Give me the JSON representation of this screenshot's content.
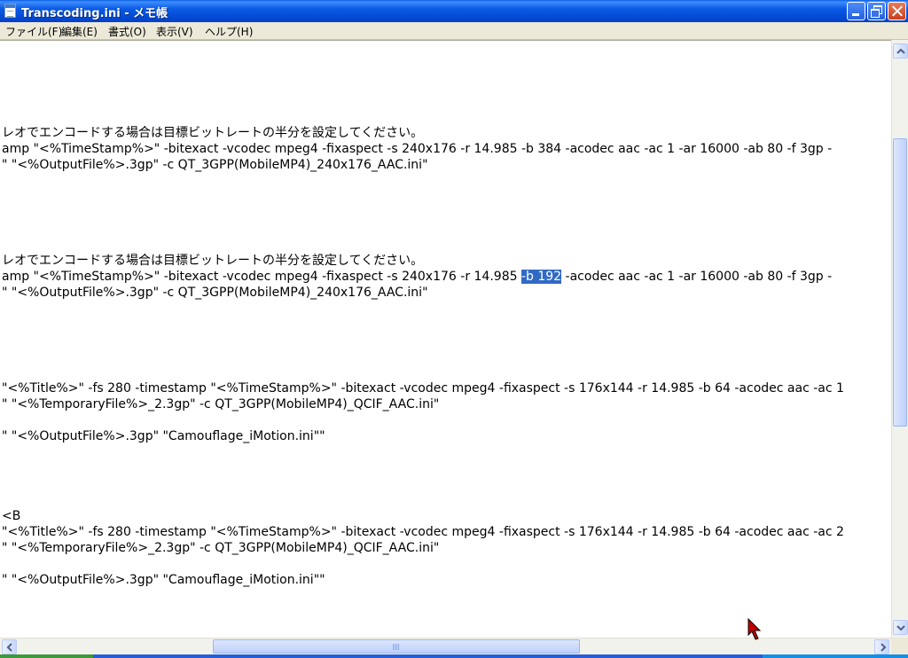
{
  "window": {
    "title": "Transcoding.ini - メモ帳"
  },
  "menu": [
    {
      "label": "ファイル(F)"
    },
    {
      "label": "編集(E)"
    },
    {
      "label": "書式(O)"
    },
    {
      "label": "表示(V)"
    },
    {
      "label": "ヘルプ(H)"
    }
  ],
  "editor": {
    "lines": [
      {
        "text": "レオでエンコードする場合は目標ビットレートの半分を設定してください。"
      },
      {
        "text": "amp \"<%TimeStamp%>\" -bitexact -vcodec mpeg4 -fixaspect -s 240x176 -r 14.985 -b 384 -acodec aac -ac 1 -ar 16000 -ab 80 -f 3gp -"
      },
      {
        "text": "\" \"<%OutputFile%>.3gp\" -c QT_3GPP(MobileMP4)_240x176_AAC.ini\""
      },
      {
        "text": "レオでエンコードする場合は目標ビットレートの半分を設定してください。"
      },
      {
        "before": "amp \"<%TimeStamp%>\" -bitexact -vcodec mpeg4 -fixaspect -s 240x176 -r 14.985 ",
        "selected": "-b 192",
        "after": " -acodec aac -ac 1 -ar 16000 -ab 80 -f 3gp -"
      },
      {
        "text": "\" \"<%OutputFile%>.3gp\" -c QT_3GPP(MobileMP4)_240x176_AAC.ini\""
      },
      {
        "text": "\"<%Title%>\" -fs 280 -timestamp \"<%TimeStamp%>\" -bitexact -vcodec mpeg4 -fixaspect -s 176x144 -r 14.985 -b 64 -acodec aac -ac 1"
      },
      {
        "text": "\" \"<%TemporaryFile%>_2.3gp\" -c QT_3GPP(MobileMP4)_QCIF_AAC.ini\""
      },
      {
        "text": "\" \"<%OutputFile%>.3gp\" \"Camouflage_iMotion.ini\"\""
      },
      {
        "text": "<B"
      },
      {
        "text": "\"<%Title%>\" -fs 280 -timestamp \"<%TimeStamp%>\" -bitexact -vcodec mpeg4 -fixaspect -s 176x144 -r 14.985 -b 64 -acodec aac -ac 2"
      },
      {
        "text": "\" \"<%TemporaryFile%>_2.3gp\" -c QT_3GPP(MobileMP4)_QCIF_AAC.ini\""
      },
      {
        "text": "\" \"<%OutputFile%>.3gp\" \"Camouflage_iMotion.ini\"\""
      }
    ]
  },
  "icons": {
    "app": "notepad-icon",
    "minimize": "minimize-icon",
    "maximize": "restore-icon",
    "close": "close-icon",
    "cursor": "mouse-pointer-icon"
  },
  "colors": {
    "titlebar": "#0b5ae5",
    "selection": "#316ac5",
    "close_button": "#d2532f"
  }
}
